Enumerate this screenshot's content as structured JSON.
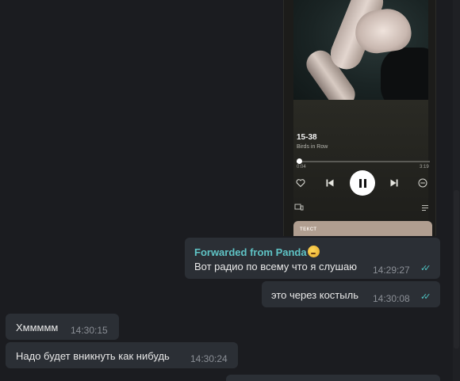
{
  "player": {
    "track_title": "15-38",
    "artist": "Birds in Row",
    "time_elapsed": "0:04",
    "time_total": "3:19",
    "progress_fraction": 0.02,
    "lyrics_label": "ТЕКСТ"
  },
  "messages": [
    {
      "id": "fwd",
      "direction": "outgoing",
      "forwarded_label": "Forwarded from Panda",
      "text": "Вот радио по всему что я слушаю",
      "time": "14:29:27",
      "read": true
    },
    {
      "id": "m2",
      "direction": "outgoing",
      "text": "это через костыль",
      "time": "14:30:08",
      "read": true
    },
    {
      "id": "m3",
      "direction": "incoming",
      "text": "Хммммм",
      "time": "14:30:15"
    },
    {
      "id": "m4",
      "direction": "incoming",
      "text": "Надо будет вникнуть как нибудь",
      "time": "14:30:24"
    }
  ],
  "colors": {
    "background": "#1b1c20",
    "bubble": "#2b2f35",
    "forwarded_accent": "#5fc3c5",
    "read_ticks": "#4fc3c2"
  },
  "icons": [
    "heart-icon",
    "previous-icon",
    "pause-icon",
    "next-icon",
    "minus-circle-icon",
    "devices-icon",
    "queue-icon",
    "thinking-emoji",
    "double-check-icon"
  ]
}
